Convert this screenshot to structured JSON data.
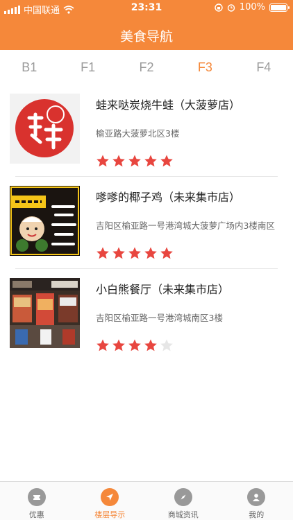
{
  "status_bar": {
    "carrier": "中国联通",
    "time": "23:31",
    "battery_percent": "100%"
  },
  "header": {
    "title": "美食导航"
  },
  "floor_tabs": [
    {
      "label": "B1",
      "active": false
    },
    {
      "label": "F1",
      "active": false
    },
    {
      "label": "F2",
      "active": false
    },
    {
      "label": "F3",
      "active": true
    },
    {
      "label": "F4",
      "active": false
    }
  ],
  "restaurants": [
    {
      "name": "蛙来哒炭烧牛蛙（大菠萝店）",
      "address": "榆亚路大菠萝北区3楼",
      "rating": 5,
      "max_rating": 5
    },
    {
      "name": "嗲嗲的椰子鸡（未来集市店）",
      "address": "吉阳区榆亚路一号港湾城大菠萝广场内3楼南区",
      "rating": 5,
      "max_rating": 5
    },
    {
      "name": "小白熊餐厅（未来集市店）",
      "address": "吉阳区榆亚路一号港湾城南区3楼",
      "rating": 4,
      "max_rating": 5
    }
  ],
  "tab_bar": [
    {
      "label": "优惠",
      "icon": "coupon-icon",
      "active": false
    },
    {
      "label": "楼层导示",
      "icon": "navigation-arrow-icon",
      "active": true
    },
    {
      "label": "商城资讯",
      "icon": "compass-icon",
      "active": false
    },
    {
      "label": "我的",
      "icon": "user-icon",
      "active": false
    }
  ],
  "colors": {
    "accent": "#F5883A",
    "star_filled": "#E8463F",
    "star_empty": "#E6E6E6"
  }
}
